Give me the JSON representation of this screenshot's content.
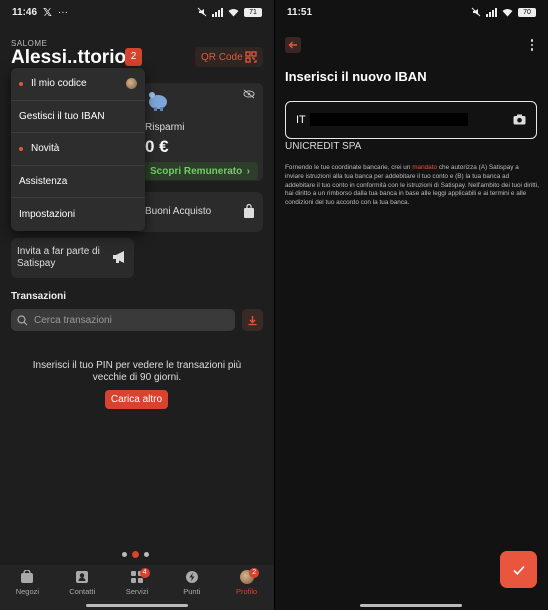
{
  "left": {
    "status": {
      "time": "11:46",
      "battery": "71"
    },
    "user": {
      "small_label": "SALOME",
      "name": "Alessi..ttorio",
      "notifications": "2"
    },
    "qr_button": "QR Code",
    "menu": [
      {
        "label": "Il mio codice",
        "dot": true,
        "avatar": true
      },
      {
        "label": "Gestisci il tuo IBAN",
        "dot": false,
        "avatar": false
      },
      {
        "label": "Novità",
        "dot": true,
        "avatar": false
      },
      {
        "label": "Assistenza",
        "dot": false,
        "avatar": false
      },
      {
        "label": "Impostazioni",
        "dot": false,
        "avatar": false
      }
    ],
    "savings": {
      "label": "Risparmi",
      "value": "0 €",
      "cta": "Scopri Remunerato"
    },
    "vouchers": {
      "label": "Buoni Acquisto"
    },
    "invite": {
      "label": "Invita a far parte di Satispay"
    },
    "transactions": {
      "title": "Transazioni",
      "search_placeholder": "Cerca transazioni",
      "pin_message": "Inserisci il tuo PIN per vedere le transazioni più vecchie di 90 giorni.",
      "load_more": "Carica altro"
    },
    "bottom_nav": [
      {
        "label": "Negozi",
        "icon": "shop-icon",
        "badge": ""
      },
      {
        "label": "Contatti",
        "icon": "contacts-icon",
        "badge": ""
      },
      {
        "label": "Servizi",
        "icon": "services-icon",
        "badge": "4"
      },
      {
        "label": "Punti",
        "icon": "bolt-icon",
        "badge": ""
      },
      {
        "label": "Profilo",
        "icon": "profile-avatar",
        "badge": "2",
        "active": true
      }
    ]
  },
  "right": {
    "status": {
      "time": "11:51",
      "battery": "70"
    },
    "title": "Inserisci il nuovo IBAN",
    "iban_value": "IT",
    "bank_name": "UNICREDIT SPA",
    "legal_before": "Fornendo le tue coordinate bancarie, crei un ",
    "legal_link": "mandato",
    "legal_after": " che autorizza (A) Satispay a inviare istruzioni alla tua banca per addebitare il tuo conto e (B) la tua banca ad addebitare il tuo conto in conformità con le istruzioni di Satispay. Nell'ambito dei tuoi diritti, hai diritto a un rimborso dalla tua banca in base alle leggi applicabili e ai termini e alle condizioni del tuo accordo con la tua banca."
  },
  "colors": {
    "accent": "#d8432f",
    "green": "#6fce62",
    "background": "#1e1e1e"
  }
}
